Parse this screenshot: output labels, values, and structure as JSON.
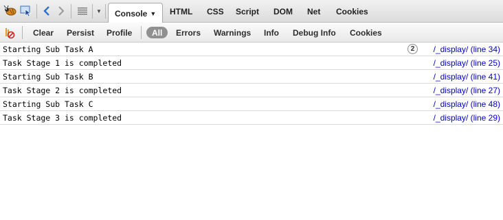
{
  "toolbar": {
    "icons": [
      "firebug-icon",
      "inspect-icon",
      "back-icon",
      "forward-icon",
      "list-icon",
      "menu-dropdown-icon"
    ],
    "tabs": [
      {
        "label": "Console",
        "selected": true
      },
      {
        "label": "HTML"
      },
      {
        "label": "CSS"
      },
      {
        "label": "Script"
      },
      {
        "label": "DOM"
      },
      {
        "label": "Net"
      },
      {
        "label": "Cookies"
      }
    ],
    "dropdown_glyph": "▼"
  },
  "filter_bar": {
    "clear_icon": "clear-console-icon",
    "buttons": {
      "clear": "Clear",
      "persist": "Persist",
      "profile": "Profile"
    },
    "filters": {
      "all": "All",
      "errors": "Errors",
      "warnings": "Warnings",
      "info": "Info",
      "debug_info": "Debug Info",
      "cookies": "Cookies"
    },
    "selected_filter": "All"
  },
  "console": {
    "rows": [
      {
        "message": "Starting Sub Task A",
        "source": "/_display/ (line 34)",
        "count": "2"
      },
      {
        "message": "Task Stage 1 is completed",
        "source": "/_display/ (line 25)"
      },
      {
        "message": "Starting Sub Task B",
        "source": "/_display/ (line 41)"
      },
      {
        "message": "Task Stage 2 is completed",
        "source": "/_display/ (line 27)"
      },
      {
        "message": "Starting Sub Task C",
        "source": "/_display/ (line 48)"
      },
      {
        "message": "Task Stage 3 is completed",
        "source": "/_display/ (line 29)"
      }
    ]
  },
  "colors": {
    "link": "#0000cc",
    "pill_bg": "#909090"
  }
}
